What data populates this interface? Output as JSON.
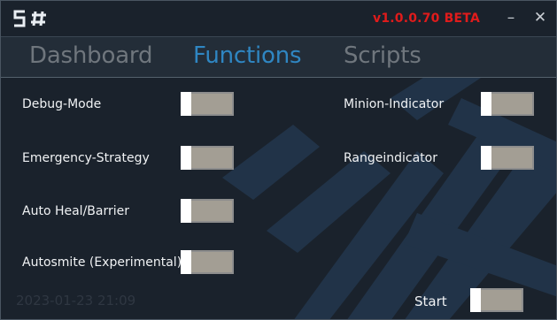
{
  "app": {
    "logo_text": "5#",
    "version": "v1.0.0.70 BETA",
    "minimize_symbol": "–",
    "close_symbol": "✕"
  },
  "tabs": [
    {
      "label": "Dashboard",
      "active": false
    },
    {
      "label": "Functions",
      "active": true
    },
    {
      "label": "Scripts",
      "active": false
    }
  ],
  "functions": {
    "left": [
      {
        "label": "Debug-Mode",
        "enabled": false
      },
      {
        "label": "Emergency-Strategy",
        "enabled": false
      },
      {
        "label": "Auto Heal/Barrier",
        "enabled": false
      },
      {
        "label": "Autosmite (Experimental)",
        "enabled": false
      }
    ],
    "right": [
      {
        "label": "Minion-Indicator",
        "enabled": false
      },
      {
        "label": "Rangeindicator",
        "enabled": false
      }
    ]
  },
  "footer": {
    "timestamp": "2023-01-23 21:09",
    "start_label": "Start",
    "start_enabled": false
  },
  "colors": {
    "accent": "#2f86c2",
    "version_red": "#e01b1b",
    "toggle_track": "#a39e94"
  }
}
